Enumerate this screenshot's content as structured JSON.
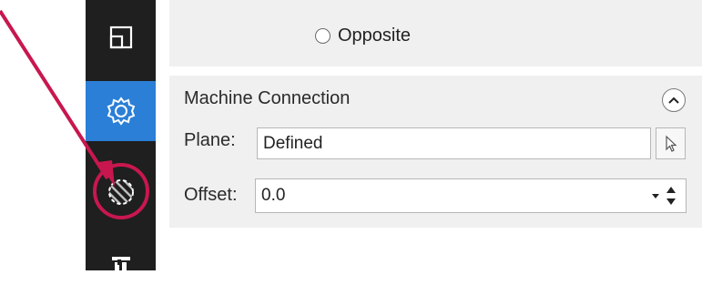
{
  "sidebar": {
    "items": [
      {
        "icon": "layout-icon"
      },
      {
        "icon": "gear-icon",
        "active": true
      },
      {
        "icon": "circle-hatched-icon"
      },
      {
        "icon": "tool-icon"
      }
    ]
  },
  "top": {
    "radio_label": "Opposite"
  },
  "machine_connection": {
    "title": "Machine Connection",
    "plane_label": "Plane:",
    "plane_value": "Defined",
    "offset_label": "Offset:",
    "offset_value": "0.0"
  },
  "colors": {
    "sidebar_bg": "#1f1f1f",
    "active_bg": "#2b7fd6",
    "annotation": "#c8174f",
    "panel_bg": "#f0f0f0"
  }
}
